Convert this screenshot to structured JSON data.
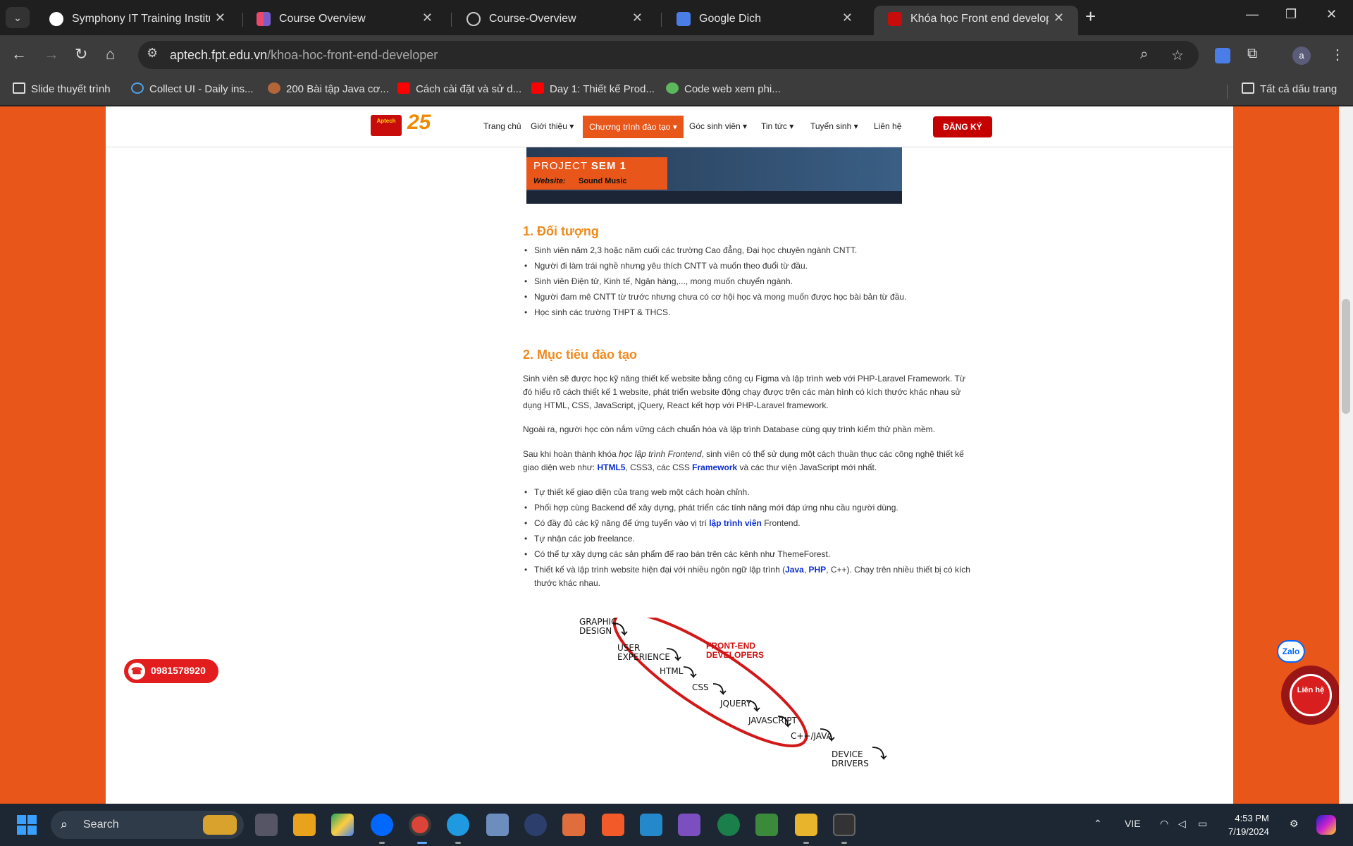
{
  "browser": {
    "tabs": [
      {
        "title": "Symphony IT Training Institute",
        "active": false
      },
      {
        "title": "Course Overview",
        "active": false
      },
      {
        "title": "Course-Overview",
        "active": false
      },
      {
        "title": "Google Dich",
        "active": false
      },
      {
        "title": "Khóa học Front end developver",
        "active": true
      }
    ],
    "url_host": "aptech.fpt.edu.vn",
    "url_path": "/khoa-hoc-front-end-developer",
    "profile_initial": "a",
    "bookmarks": [
      "Slide thuyết trình",
      "Collect UI - Daily ins...",
      "200 Bài tập Java cơ...",
      "Cách cài đặt và sử d...",
      "Day 1: Thiết kế Prod...",
      "Code web xem phi..."
    ],
    "all_bookmarks": "Tất cả dấu trang"
  },
  "site": {
    "logo_text": "Aptech",
    "logo_25": "25",
    "menu": [
      "Trang chủ",
      "Giới thiệu",
      "Chương trình đào tạo",
      "Góc sinh viên",
      "Tin tức",
      "Tuyển sinh",
      "Liên hệ"
    ],
    "register": "ĐĂNG KÝ"
  },
  "banner": {
    "project": "PROJECT",
    "sem": "SEM 1",
    "website_label": "Website:",
    "website_name": "Sound Music"
  },
  "article": {
    "section1_title": "1. Đối tượng",
    "section1_items": [
      "Sinh viên năm 2,3 hoặc năm cuối các trường Cao đẳng, Đại học chuyên ngành CNTT.",
      "Người đi làm trái nghề nhưng yêu thích CNTT và muốn theo đuổi từ đầu.",
      "Sinh viên Điện tử, Kinh tế, Ngân hàng,..., mong muốn chuyển ngành.",
      "Người đam mê CNTT từ trước nhưng chưa có cơ hội học và mong muốn được học bài bản từ đầu.",
      "Học sinh các trường THPT & THCS."
    ],
    "section2_title": "2. Mục tiêu đào tạo",
    "para1": "Sinh viên sẽ được học kỹ năng thiết kế website bằng công cụ Figma và lập trình web với PHP-Laravel Framework. Từ đó hiểu rõ cách thiết kế 1 website, phát triển website động chạy được trên các màn hình có kích thước khác nhau sử dụng HTML, CSS, JavaScript, jQuery, React kết hợp với PHP-Laravel framework.",
    "para2": "Ngoài ra, người học còn nắm vững cách chuẩn hóa và lập trình Database cùng quy trình kiểm thử phần mềm.",
    "para3_a": "Sau khi hoàn thành khóa ",
    "para3_em": "học lập trình Frontend",
    "para3_b": ", sinh viên có thể sử dụng một cách thuần thục các công nghệ thiết kế giao diện web như: ",
    "para3_link1": "HTML5",
    "para3_c": ", CSS3, các CSS ",
    "para3_link2": "Framework",
    "para3_d": " và các thư viện JavaScript mới nhất.",
    "goal_item1": "Tự thiết kế giao diện của trang web một cách hoàn chỉnh.",
    "goal_item2": "Phối hợp cùng Backend để xây dựng, phát triển các tính năng mới đáp ứng nhu cầu người dùng.",
    "goal_item3_a": "Có đầy đủ các kỹ năng để ứng tuyển vào vị trí ",
    "goal_item3_link": "lập trình viên",
    "goal_item3_b": " Frontend.",
    "goal_item4": "Tự nhận các job freelance.",
    "goal_item5": "Có thể tự xây dựng các sản phẩm để rao bán trên các kênh như ThemeForest.",
    "goal_item6_a": "Thiết kế và lập trình website hiện đại với nhiều ngôn ngữ lập trình (",
    "goal_item6_java": "Java",
    "goal_item6_sep": ", ",
    "goal_item6_php": "PHP",
    "goal_item6_b": ", C++). Chạy trên nhiều thiết bị có kích thước khác nhau."
  },
  "diagram": {
    "steps": [
      "GRAPHIC DESIGN",
      "USER EXPERIENCE",
      "HTML",
      "CSS",
      "JQUERY",
      "JAVASCRIPT",
      "C++/JAVA",
      "DEVICE DRIVERS"
    ],
    "highlight": "FRONT-END DEVELOPERS"
  },
  "floating": {
    "phone": "0981578920",
    "zalo": "Zalo",
    "contact": "Liên hệ"
  },
  "taskbar": {
    "search": "Search",
    "lang": "VIE",
    "time": "4:53 PM",
    "date": "7/19/2024"
  }
}
